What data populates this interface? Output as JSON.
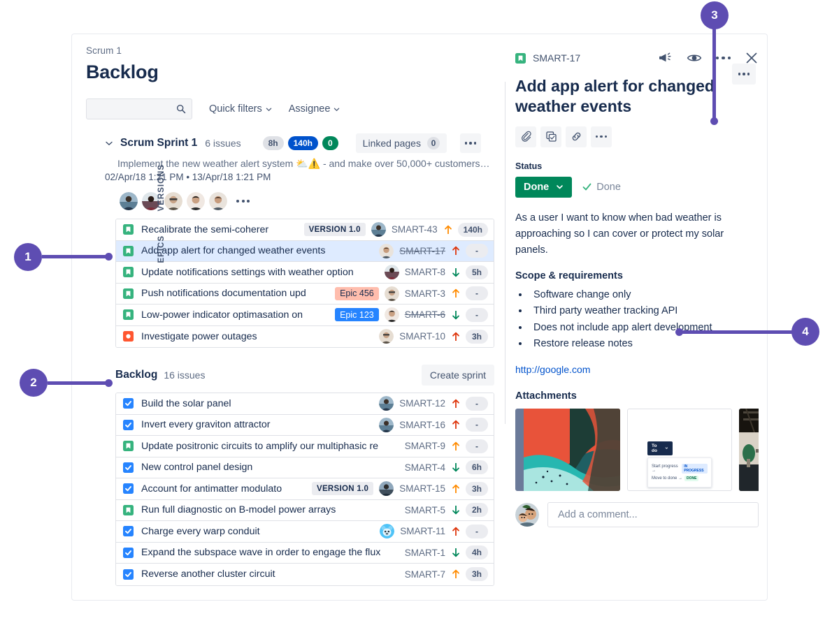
{
  "breadcrumb": "Scrum 1",
  "page_title": "Backlog",
  "toolbar": {
    "search_placeholder": "",
    "quick_filters_label": "Quick filters",
    "assignee_label": "Assignee"
  },
  "rail": {
    "versions": "VERSIONS",
    "epics": "EPICS"
  },
  "sprint": {
    "name": "Scrum Sprint 1",
    "issues_count": "6 issues",
    "pill_grey": "8h",
    "pill_blue": "140h",
    "pill_green": "0",
    "linked_pages_label": "Linked pages",
    "linked_pages_count": "0",
    "goal": "Implement the new weather alert system ⛅⚠️ - and make over 50,000+ customers…",
    "dates": "02/Apr/18 1:21 PM • 13/Apr/18 1:21 PM"
  },
  "sprint_issues": [
    {
      "type": "story",
      "summary": "Recalibrate the semi-coherer",
      "badge": "VERSION 1.0",
      "badge_kind": "version",
      "avatar": 1,
      "key": "SMART-43",
      "key_struck": false,
      "priority": "up-medium",
      "estimate": "140h",
      "selected": false
    },
    {
      "type": "story",
      "summary": "Add app alert for changed weather events",
      "badge": "",
      "badge_kind": "",
      "avatar": 5,
      "key": "SMART-17",
      "key_struck": true,
      "priority": "up-high",
      "estimate": "-",
      "selected": true
    },
    {
      "type": "story",
      "summary": "Update notifications settings with weather option",
      "badge": "",
      "badge_kind": "",
      "avatar": 2,
      "key": "SMART-8",
      "key_struck": false,
      "priority": "down",
      "estimate": "5h",
      "selected": false
    },
    {
      "type": "story",
      "summary": "Push notifications documentation upd",
      "badge": "Epic 456",
      "badge_kind": "epic456",
      "avatar": 3,
      "key": "SMART-3",
      "key_struck": false,
      "priority": "up-medium",
      "estimate": "-",
      "selected": false
    },
    {
      "type": "story",
      "summary": "Low-power indicator optimasation on",
      "badge": "Epic 123",
      "badge_kind": "epic123",
      "avatar": 4,
      "key": "SMART-6",
      "key_struck": true,
      "priority": "down",
      "estimate": "-",
      "selected": false
    },
    {
      "type": "bug",
      "summary": "Investigate power outages",
      "badge": "",
      "badge_kind": "",
      "avatar": 3,
      "key": "SMART-10",
      "key_struck": false,
      "priority": "up-high",
      "estimate": "3h",
      "selected": false
    }
  ],
  "backlog": {
    "title": "Backlog",
    "count": "16 issues",
    "create_sprint_label": "Create sprint"
  },
  "backlog_issues": [
    {
      "type": "task",
      "summary": "Build the solar panel",
      "badge": "",
      "badge_kind": "",
      "avatar": 1,
      "key": "SMART-12",
      "key_struck": false,
      "priority": "up-high",
      "estimate": "-"
    },
    {
      "type": "task",
      "summary": "Invert every graviton attractor",
      "badge": "",
      "badge_kind": "",
      "avatar": 1,
      "key": "SMART-16",
      "key_struck": false,
      "priority": "up-high",
      "estimate": "-"
    },
    {
      "type": "story",
      "summary": "Update positronic circuits to amplify our multiphasic re",
      "badge": "",
      "badge_kind": "",
      "avatar": 0,
      "key": "SMART-9",
      "key_struck": false,
      "priority": "up-medium",
      "estimate": "-"
    },
    {
      "type": "task",
      "summary": "New control panel design",
      "badge": "",
      "badge_kind": "",
      "avatar": 0,
      "key": "SMART-4",
      "key_struck": false,
      "priority": "down",
      "estimate": "6h"
    },
    {
      "type": "task",
      "summary": "Account for antimatter modulato",
      "badge": "VERSION 1.0",
      "badge_kind": "version",
      "avatar": 6,
      "key": "SMART-15",
      "key_struck": false,
      "priority": "up-medium",
      "estimate": "3h"
    },
    {
      "type": "story",
      "summary": "Run full diagnostic on B-model power arrays",
      "badge": "",
      "badge_kind": "",
      "avatar": 0,
      "key": "SMART-5",
      "key_struck": false,
      "priority": "down",
      "estimate": "2h"
    },
    {
      "type": "task",
      "summary": "Charge every warp conduit",
      "badge": "",
      "badge_kind": "",
      "avatar": 7,
      "key": "SMART-11",
      "key_struck": false,
      "priority": "up-high",
      "estimate": "-"
    },
    {
      "type": "task",
      "summary": "Expand the subspace wave in order to engage the flux",
      "badge": "",
      "badge_kind": "",
      "avatar": 0,
      "key": "SMART-1",
      "key_struck": false,
      "priority": "down",
      "estimate": "4h"
    },
    {
      "type": "task",
      "summary": "Reverse another cluster circuit",
      "badge": "",
      "badge_kind": "",
      "avatar": 0,
      "key": "SMART-7",
      "key_struck": false,
      "priority": "up-medium",
      "estimate": "3h"
    }
  ],
  "detail": {
    "key": "SMART-17",
    "title": "Add app alert for changed weather events",
    "status_label": "Status",
    "status_value": "Done",
    "status_check": "Done",
    "description": "As a user I want to know when bad weather is approaching so I can cover or protect my solar panels.",
    "scope_heading": "Scope & requirements",
    "scope_items": [
      "Software change only",
      "Third party weather tracking API",
      "Does not include app alert development",
      "Restore release notes"
    ],
    "link": "http://google.com",
    "attachments_label": "Attachments",
    "comment_placeholder": "Add a comment...",
    "mock": {
      "button": "To do",
      "item1": "Start progress →",
      "tag1": "IN PROGRESS",
      "item2": "Move to done →",
      "tag2": "DONE"
    }
  },
  "callouts": [
    {
      "number": "1"
    },
    {
      "number": "2"
    },
    {
      "number": "3"
    },
    {
      "number": "4"
    }
  ],
  "colors": {
    "accent_purple": "#5e4db2",
    "brand_blue": "#0052cc",
    "green": "#00875a",
    "story_green": "#36b37e",
    "bug_red": "#ff5630",
    "task_blue": "#2684ff",
    "selected_row": "#deebff"
  }
}
